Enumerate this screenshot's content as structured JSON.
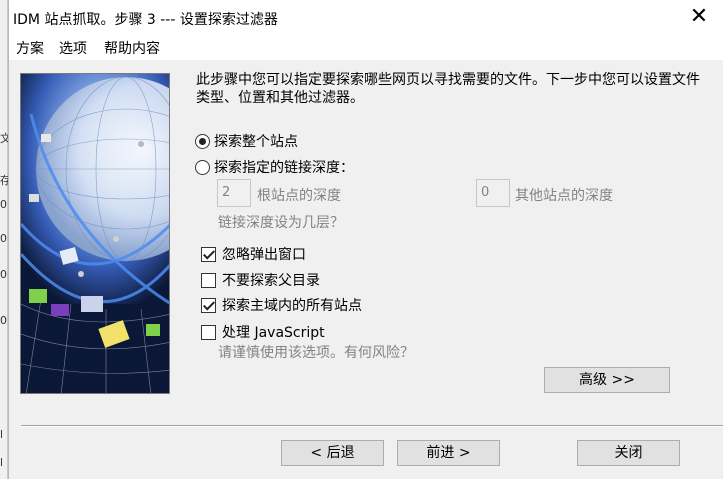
{
  "window": {
    "title": "IDM 站点抓取。步骤 3 --- 设置探索过滤器",
    "close_glyph": "✕"
  },
  "menu": [
    {
      "label": "方案"
    },
    {
      "label": "选项"
    },
    {
      "label": "帮助内容"
    }
  ],
  "intro_text": "此步骤中您可以指定要探索哪些网页以寻找需要的文件。下一步中您可以设置文件类型、位置和其他过滤器。",
  "explore_scope": {
    "options": [
      {
        "label": "探索整个站点",
        "selected": true
      },
      {
        "label": "探索指定的链接深度：",
        "selected": false
      }
    ],
    "root_depth_value": "2",
    "root_depth_label": "根站点的深度",
    "other_depth_value": "0",
    "other_depth_label": "其他站点的深度",
    "depth_help_link": "链接深度设为几层？"
  },
  "options": [
    {
      "label": "忽略弹出窗口",
      "checked": true
    },
    {
      "label": "不要探索父目录",
      "checked": false
    },
    {
      "label": "探索主域内的所有站点",
      "checked": true
    },
    {
      "label": "处理 JavaScript",
      "checked": false
    }
  ],
  "js_warning": "请谨慎使用该选项。有何风险？",
  "buttons": {
    "advanced": "高级 >>",
    "back": "< 后退",
    "next": "前进 >",
    "close": "关闭"
  },
  "background_window_fragments": [
    "文",
    "存",
    "0",
    "0",
    "0",
    "0",
    "l",
    "l"
  ]
}
